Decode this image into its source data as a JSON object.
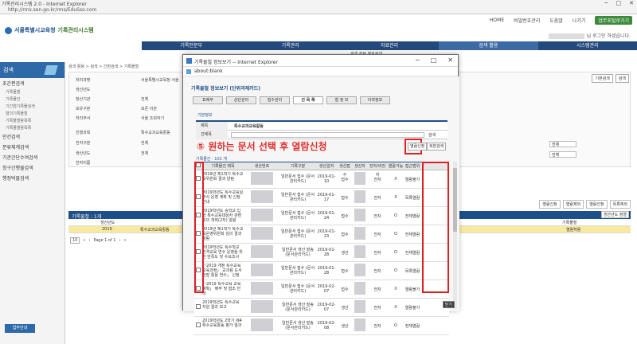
{
  "browser": {
    "title": "기록관리시스템 2.0 - Internet Explorer",
    "url": "http://rms.sen.go.kr/rms/EduSso.com",
    "controls": [
      "─",
      "□",
      "✕"
    ]
  },
  "toplinks": [
    "HOME",
    "비밀번호관리",
    "도움말",
    "나가기",
    "업무포털로가기"
  ],
  "logo": {
    "org": "서울특별시교육청",
    "sys": "기록관리시스템"
  },
  "welcome": "님 로그인 하셨습니다.",
  "nav": [
    "기록전문부",
    "기록관리",
    "자료관리",
    "검색 활용",
    "시스템관리"
  ],
  "subnav": "검색   자료   정보검색",
  "side": {
    "title": "검색",
    "sections": [
      "초간편검색",
      "안건검색",
      "분류체계검색",
      "기관간단수여검색",
      "창구간행물검색",
      "행정박물검색"
    ],
    "subs": [
      "기록물철",
      "기록물건",
      "기간형기록물검색",
      "협의기록물철",
      "기록물열람목록",
      "기록물열람목록"
    ],
    "quick": "업무안내"
  },
  "breadcrumb": "검색 활용 > 검색 > 간편검색 > 기록물철",
  "form": {
    "labels": [
      "처리과명",
      "생산년도",
      "청산기관",
      "보유구분",
      "처리부서",
      "진행과목",
      "전자구분",
      "생산년도",
      "한자이름"
    ],
    "values": [
      "서울특별시교육청 서울",
      "",
      "전체",
      "보존  이관  ",
      "서울   조회하기",
      "특수교과교육활동",
      "전체",
      "전체",
      ""
    ]
  },
  "right_buttons": [
    "기본검색",
    "검색"
  ],
  "action_buttons": [
    "열람신청",
    "열람제외",
    "열람선정",
    "목록제외"
  ],
  "bg_table": {
    "title": "기록물철 : 1개",
    "header": [
      "생산년도",
      "",
      "기록물철"
    ],
    "row": [
      "2019",
      "특수교과교육활동",
      "열람허용"
    ],
    "sort": "생산년도 정렬"
  },
  "pager": {
    "size": "10",
    "label": "Page 1 of 1"
  },
  "popup": {
    "title": "기록물철 정보보기 -- Internet Explorer",
    "address": "about:blank",
    "header": "기록물철 정보보기 (단위과제카드)",
    "tabs": [
      "표제부",
      "상단관리",
      "접수관리",
      "건 목 록",
      "철 정 보",
      "이력정보"
    ],
    "cond_title": "기본정보",
    "title_label": "제목",
    "title_value": "특수교과교육활동",
    "search_label": "건제목",
    "search_btn": "검색",
    "instruction": "⑤ 원하는 문서 선택 후 열람신청",
    "btn_request": "열람신청",
    "btn_exclude": "복본검색",
    "count": "기록물건 : 101 개",
    "columns": [
      "",
      "기록물건 제목",
      "생산번호",
      "기록구분",
      "생산일자",
      "생산접수",
      "생산자",
      "전자/비전자",
      "열람가능",
      "접근범위"
    ],
    "rows": [
      {
        "title": "2019년 제1학기 특수교육위원회 결과 알림",
        "type": "일반문서 접수 (문서관리카드)",
        "date": "2019-01-10",
        "rec": "접수",
        "elec": "전자",
        "can": "X",
        "scope": "열람불가"
      },
      {
        "title": "2019학년도 특수교육실무사 운영 계획 및 신청 안내",
        "type": "일반문서 접수 (문서관리카드)",
        "date": "2019-01-17",
        "rec": "접수",
        "elec": "전자",
        "can": "X",
        "scope": "목록열람"
      },
      {
        "title": "2019학년도 중학교 입학 특수교육대상자 관련 회의 개최(2차) 알림",
        "type": "일반문서 접수 (문서관리카드)",
        "date": "2019-01-24",
        "rec": "접수",
        "elec": "전자",
        "can": "O",
        "scope": "전체열람"
      },
      {
        "title": "2019년 제1학기 특수교육운영위원회 심의 결과 알림",
        "type": "일반문서 접수 (문서관리카드)",
        "date": "2019-01-23",
        "rec": "접수",
        "elec": "전자",
        "can": "O",
        "scope": "전체열람"
      },
      {
        "title": "2019학년도 특수학교 원격교육 연수 운영을 위한 만족도 및 수요조사 실시",
        "type": "일반문서 생산 발송 (문서관리카드)",
        "date": "2019-01-28",
        "rec": "생산",
        "elec": "전자",
        "can": "O",
        "scope": "전체열람"
      },
      {
        "title": "「2019 개정 특수교육 교육과정」 교과용 도서 현장 활용 연수」 신청 안내",
        "type": "일반문서 접수 (문서관리카드)",
        "date": "2019-01-28",
        "rec": "접수",
        "elec": "전자",
        "can": "O",
        "scope": "목록열람"
      },
      {
        "title": "「2019 특수교육 교육계획」 배부 및 협조 안내",
        "type": "일반문서 접수 (문서관리카드)",
        "date": "2019-02-07",
        "rec": "접수",
        "elec": "전자",
        "can": "X",
        "scope": "열람불가"
      },
      {
        "title": "2019학년도 특수교육 지원 결과 보고",
        "type": "일반문서 생산 발송 (문서관리카드)",
        "date": "2019-02-07",
        "rec": "생산",
        "elec": "전자",
        "can": "X",
        "scope": "열람불가"
      },
      {
        "title": "2019학년도 2학기 제4 특수교육활동 평가 결과",
        "type": "일반문서 생산 발송 (문서관리카드)",
        "date": "2019-02-08",
        "rec": "생산",
        "elec": "전자",
        "can": "O",
        "scope": "전체열람"
      }
    ],
    "close": "닫기"
  }
}
